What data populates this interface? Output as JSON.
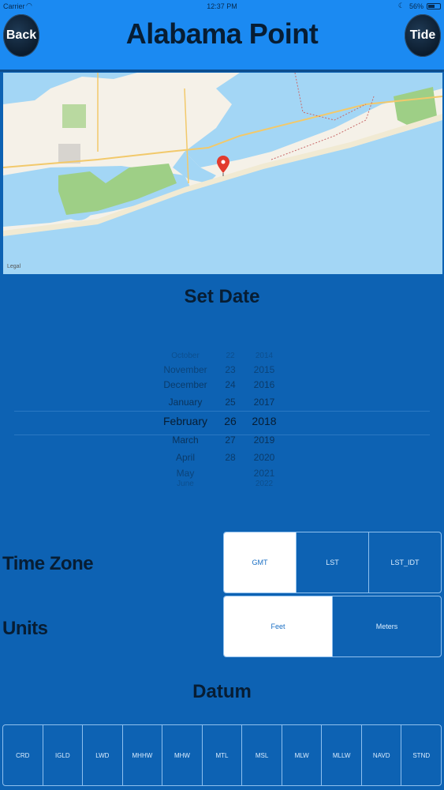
{
  "status": {
    "carrier": "Carrier",
    "time": "12:37 PM",
    "battery": "56%"
  },
  "header": {
    "title": "Alabama Point",
    "back_label": "Back",
    "tide_label": "Tide"
  },
  "map": {
    "legal": "Legal"
  },
  "set_date": {
    "title": "Set Date",
    "months": [
      "October",
      "November",
      "December",
      "January",
      "February",
      "March",
      "April",
      "May",
      "June"
    ],
    "days": [
      "22",
      "23",
      "24",
      "25",
      "26",
      "27",
      "28",
      "",
      ""
    ],
    "years": [
      "2014",
      "2015",
      "2016",
      "2017",
      "2018",
      "2019",
      "2020",
      "2021",
      "2022"
    ],
    "selected": {
      "month": "February",
      "day": "26",
      "year": "2018"
    }
  },
  "time_zone": {
    "label": "Time Zone",
    "options": [
      "GMT",
      "LST",
      "LST_IDT"
    ],
    "selected": "GMT"
  },
  "units": {
    "label": "Units",
    "options": [
      "Feet",
      "Meters"
    ],
    "selected": "Feet"
  },
  "datum": {
    "title": "Datum",
    "options": [
      "CRD",
      "IGLD",
      "LWD",
      "MHHW",
      "MHW",
      "MTL",
      "MSL",
      "MLW",
      "MLLW",
      "NAVD",
      "STND"
    ]
  },
  "colors": {
    "nav_bg": "#1b8af2",
    "body_bg": "#0d62b3",
    "water": "#a3d6f5",
    "park": "#9ecf86"
  }
}
